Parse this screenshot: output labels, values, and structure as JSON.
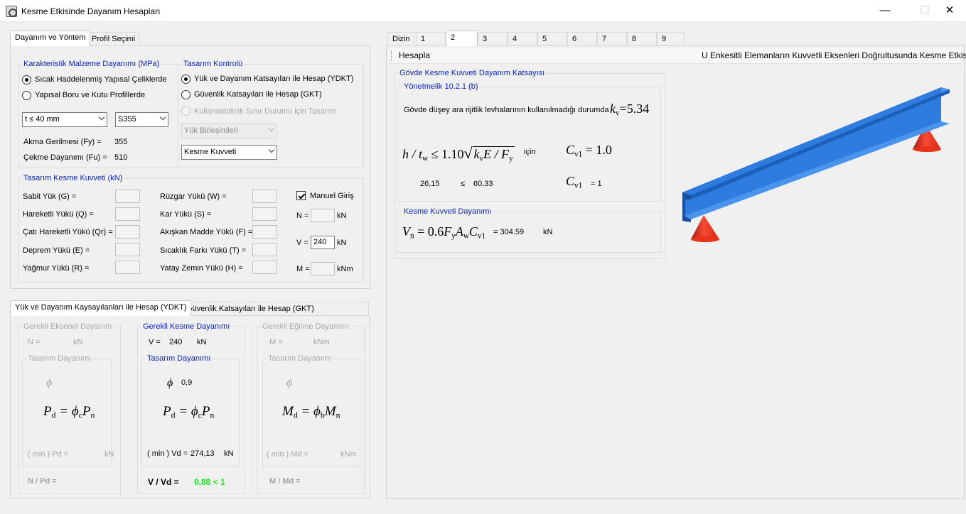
{
  "window": {
    "title": "Kesme Etkisinde Dayanım Hesapları",
    "minimize": "—",
    "maximize": "☐",
    "close": "✕"
  },
  "left_tabs": [
    "Dayanım ve Yöntem",
    "Profil Seçimi"
  ],
  "material": {
    "title": "Karakteristik Malzeme Dayanımı (MPa)",
    "radio1": "Sıcak Haddelenmiş Yapısal Çeliklerde",
    "radio2": "Yapısal Boru ve Kutu Profillerde",
    "thickness": "t ≤ 40 mm",
    "steel": "S355",
    "fy_label": "Akma Gerilmesi (Fy) =",
    "fy": "355",
    "fu_label": "Çekme Dayanımı (Fu) =",
    "fu": "510"
  },
  "design_check": {
    "title": "Tasarım Kontrolü",
    "radio1": "Yük ve Dayanım Katsayıları ile Hesap (YDKT)",
    "radio2": "Güvenlik Katsayıları ile Hesap (GKT)",
    "radio3": "Kullanılabilirlik Sınır Durumu için Tasarım",
    "combo1": "Yük Birleşimleri",
    "combo2": "Kesme Kuvveti"
  },
  "loads": {
    "title": "Tasarım Kesme Kuvveti (kN)",
    "left": [
      "Sabit Yük (G) =",
      "Hareketli Yükü (Q) =",
      "Çatı Hareketli Yükü (Qr) =",
      "Deprem Yükü (E) =",
      "Yağmur Yükü (R) ="
    ],
    "mid": [
      "Rüzgar Yükü (W) =",
      "Kar Yükü (S) =",
      "Akışkan Madde Yükü (F) =",
      "Sıcaklık Farkı Yükü (T) =",
      "Yatay Zemin Yükü (H) ="
    ],
    "manual": "Manuel Giriş",
    "n_label": "N =",
    "n_value": "",
    "n_unit": "kN",
    "v_label": "V =",
    "v_value": "240",
    "v_unit": "kN",
    "m_label": "M =",
    "m_value": "",
    "m_unit": "kNm"
  },
  "bottom_tabs": [
    "Yük ve Dayanım Kaysayılanları ile Hesap (YDKT)",
    "Güvenlik Katsayıları ile Hesap (GKT)"
  ],
  "axial": {
    "title": "Gerekli Eksenel Dayanım",
    "n": "N =",
    "unit": "kN",
    "sub_title": "Tasarım Dayanımı",
    "phi": "ϕ",
    "f_lhs": "P",
    "f_lsub": "d",
    "f_mid": "= ϕ",
    "f_msub": "c",
    "f_rhs": "P",
    "f_rsub": "n",
    "min_label": "( min ) Pd =",
    "min_unit": "kN",
    "ratio": "N / Pd ="
  },
  "shear": {
    "title": "Gerekli Kesme Dayanımı",
    "v": "V =",
    "v_value": "240",
    "unit": "kN",
    "sub_title": "Tasarım Dayanımı",
    "phi": "ϕ",
    "phi_value": "0,9",
    "f_lhs": "P",
    "f_lsub": "d",
    "f_mid": "= ϕ",
    "f_msub": "c",
    "f_rhs": "P",
    "f_rsub": "n",
    "min_label": "( min ) Vd =",
    "min_value": "274,13",
    "min_unit": "kN",
    "ratio": "V / Vd =",
    "ratio_value": "0,88 < 1"
  },
  "bending": {
    "title": "Gerekli Eğilme Dayanımı",
    "m": "M =",
    "unit": "kNm",
    "sub_title": "Tasarım Dayanımı",
    "phi": "ϕ",
    "f_lhs": "M",
    "f_lsub": "d",
    "f_mid": "= ϕ",
    "f_msub": "b",
    "f_rhs": "M",
    "f_rsub": "n",
    "min_label": "( min ) Md =",
    "min_unit": "kNm",
    "ratio": "M / Md ="
  },
  "right_tabs": [
    "Dizin",
    "1",
    "2",
    "3",
    "4",
    "5",
    "6",
    "7",
    "8",
    "9"
  ],
  "right_tab_active": "2",
  "toolbar": {
    "calculate": "Hesapla",
    "heading": "U Enkesitli Elemanların Kuvvetli Eksenleri Doğrultusunda Kesme Etkisi"
  },
  "coef": {
    "title": "Gövde Kesme Kuvveti Dayanım Katsayısı",
    "reg_title": "Yönetmelik 10.2.1 (b)",
    "text": "Gövde düşey ara rijitlik levhalarının kullanılmadığı durumda",
    "kv": "5.34",
    "cond_lhs": "h / t",
    "cond_sub": "w",
    "cond_mid": "≤ 1.10",
    "cond_sqrt": "k",
    "cond_sqrt_sub": "v",
    "cond_sqrt_rest": "E / F",
    "cond_sqrt_sub2": "y",
    "for": "için",
    "cv_label": "C",
    "cv_sub": "v1",
    "cv_eq": "= 1.0",
    "val_lhs": "26,15",
    "val_op": "≤",
    "val_rhs": "60,33",
    "cv_value": "= 1"
  },
  "nominal": {
    "title": "Kesme Kuvveti Dayanımı",
    "formula": "= 0.6",
    "value": "= 304.59",
    "unit": "kN"
  },
  "colors": {
    "accent": "#0a22c4",
    "pass": "#19e619",
    "beam": "#2f7ce0",
    "support": "#f03020"
  }
}
